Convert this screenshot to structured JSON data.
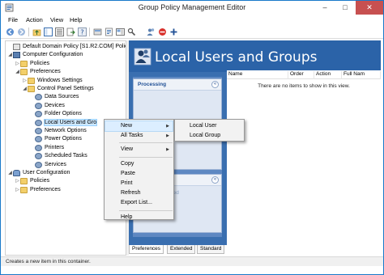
{
  "window": {
    "title": "Group Policy Management Editor",
    "controls": {
      "minimize": "–",
      "maximize": "□",
      "close": "✕"
    },
    "accent": "#1979ca"
  },
  "menubar": {
    "items": [
      "File",
      "Action",
      "View",
      "Help"
    ]
  },
  "toolbar": {
    "buttons": [
      "back-icon",
      "forward-icon",
      "up-folder-icon",
      "show-tree-icon",
      "list-icon",
      "export-icon",
      "help-icon",
      "refresh-icon",
      "properties-icon",
      "stop-icon",
      "add-icon"
    ]
  },
  "tree": {
    "items": [
      {
        "label": "Default Domain Policy [S1.R2.COM] Policy",
        "indent": 0,
        "expander": "",
        "icon": "policy-icon"
      },
      {
        "label": "Computer Configuration",
        "indent": 0,
        "expander": "◢",
        "icon": "computer-icon"
      },
      {
        "label": "Policies",
        "indent": 1,
        "expander": "▷",
        "icon": "folder-icon"
      },
      {
        "label": "Preferences",
        "indent": 1,
        "expander": "◢",
        "icon": "folder-icon"
      },
      {
        "label": "Windows Settings",
        "indent": 2,
        "expander": "▷",
        "icon": "folder-icon"
      },
      {
        "label": "Control Panel Settings",
        "indent": 2,
        "expander": "◢",
        "icon": "folder-icon"
      },
      {
        "label": "Data Sources",
        "indent": 3,
        "expander": "",
        "icon": "data-sources-icon"
      },
      {
        "label": "Devices",
        "indent": 3,
        "expander": "",
        "icon": "devices-icon"
      },
      {
        "label": "Folder Options",
        "indent": 3,
        "expander": "",
        "icon": "folder-options-icon"
      },
      {
        "label": "Local Users and Gro",
        "indent": 3,
        "expander": "",
        "icon": "users-icon",
        "selected": true
      },
      {
        "label": "Network Options",
        "indent": 3,
        "expander": "",
        "icon": "network-icon"
      },
      {
        "label": "Power Options",
        "indent": 3,
        "expander": "",
        "icon": "power-icon"
      },
      {
        "label": "Printers",
        "indent": 3,
        "expander": "",
        "icon": "printer-icon"
      },
      {
        "label": "Scheduled Tasks",
        "indent": 3,
        "expander": "",
        "icon": "scheduled-tasks-icon"
      },
      {
        "label": "Services",
        "indent": 3,
        "expander": "",
        "icon": "services-icon"
      },
      {
        "label": "User Configuration",
        "indent": 0,
        "expander": "◢",
        "icon": "user-icon"
      },
      {
        "label": "Policies",
        "indent": 1,
        "expander": "▷",
        "icon": "folder-icon"
      },
      {
        "label": "Preferences",
        "indent": 1,
        "expander": "▷",
        "icon": "folder-icon"
      }
    ]
  },
  "main": {
    "banner_title": "Local Users and Groups",
    "processing_title": "Processing",
    "collapse_glyph": "«",
    "partial_text": "ected",
    "columns": [
      "Name",
      "Order",
      "Action",
      "Full Nam"
    ],
    "empty_message": "There are no items to show in this view.",
    "banner_color": "#2b63a8"
  },
  "tabs": [
    "Preferences",
    "Extended",
    "Standard"
  ],
  "active_tab": "Preferences",
  "context_menu": {
    "items": [
      {
        "label": "New",
        "submenu": true,
        "hover": true
      },
      {
        "label": "All Tasks",
        "submenu": true
      },
      {
        "separator": true
      },
      {
        "label": "View",
        "submenu": true
      },
      {
        "separator": true
      },
      {
        "label": "Copy"
      },
      {
        "label": "Paste"
      },
      {
        "label": "Print"
      },
      {
        "label": "Refresh"
      },
      {
        "label": "Export List..."
      },
      {
        "separator": true
      },
      {
        "label": "Help"
      }
    ],
    "submenu_glyph": "▶"
  },
  "submenu": {
    "items": [
      "Local User",
      "Local Group"
    ]
  },
  "status": {
    "text": "Creates a new item in this container."
  }
}
